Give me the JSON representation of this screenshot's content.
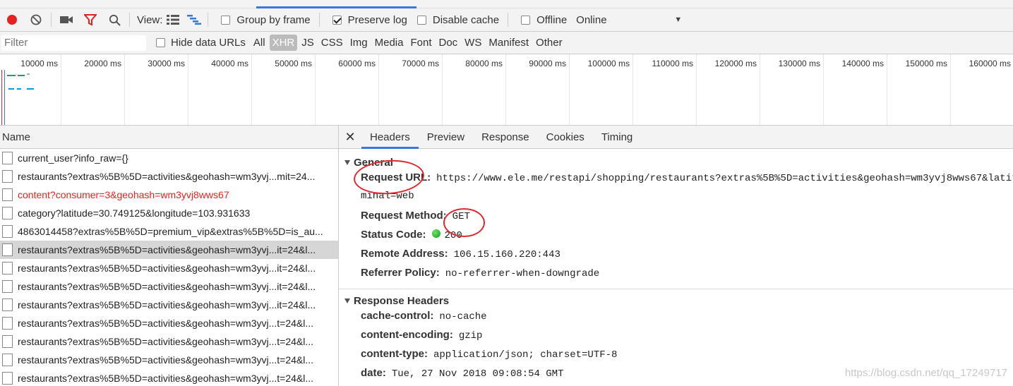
{
  "toolbar": {
    "view_label": "View:",
    "group_by_frame": "Group by frame",
    "preserve_log": "Preserve log",
    "disable_cache": "Disable cache",
    "offline": "Offline",
    "throttle": "Online"
  },
  "filterbar": {
    "placeholder": "Filter",
    "hide_data_urls": "Hide data URLs",
    "types": [
      "All",
      "XHR",
      "JS",
      "CSS",
      "Img",
      "Media",
      "Font",
      "Doc",
      "WS",
      "Manifest",
      "Other"
    ],
    "active_type": "XHR"
  },
  "overview": {
    "ticks": [
      "10000 ms",
      "20000 ms",
      "30000 ms",
      "40000 ms",
      "50000 ms",
      "60000 ms",
      "70000 ms",
      "80000 ms",
      "90000 ms",
      "100000 ms",
      "110000 ms",
      "120000 ms",
      "130000 ms",
      "140000 ms",
      "150000 ms",
      "160000 ms"
    ]
  },
  "requests": {
    "header": "Name",
    "rows": [
      {
        "label": "current_user?info_raw={}"
      },
      {
        "label": "restaurants?extras%5B%5D=activities&geohash=wm3yvj...mit=24..."
      },
      {
        "label": "content?consumer=3&geohash=wm3yvj8wws67",
        "error": true
      },
      {
        "label": "category?latitude=30.749125&longitude=103.931633"
      },
      {
        "label": "4863014458?extras%5B%5D=premium_vip&extras%5B%5D=is_au..."
      },
      {
        "label": "restaurants?extras%5B%5D=activities&geohash=wm3yvj...it=24&l...",
        "selected": true
      },
      {
        "label": "restaurants?extras%5B%5D=activities&geohash=wm3yvj...it=24&l..."
      },
      {
        "label": "restaurants?extras%5B%5D=activities&geohash=wm3yvj...it=24&l..."
      },
      {
        "label": "restaurants?extras%5B%5D=activities&geohash=wm3yvj...it=24&l..."
      },
      {
        "label": "restaurants?extras%5B%5D=activities&geohash=wm3yvj...t=24&l..."
      },
      {
        "label": "restaurants?extras%5B%5D=activities&geohash=wm3yvj...t=24&l..."
      },
      {
        "label": "restaurants?extras%5B%5D=activities&geohash=wm3yvj...t=24&l..."
      },
      {
        "label": "restaurants?extras%5B%5D=activities&geohash=wm3yvj...t=24&l..."
      }
    ]
  },
  "detail": {
    "tabs": [
      "Headers",
      "Preview",
      "Response",
      "Cookies",
      "Timing"
    ],
    "active_tab": "Headers",
    "general": {
      "title": "General",
      "request_url_label": "Request URL:",
      "request_url": "https://www.ele.me/restapi/shopping/restaurants?extras%5B%5D=activities&geohash=wm3yvj8wws67&latitud",
      "request_url_cont": "minal=web",
      "method_label": "Request Method:",
      "method": "GET",
      "status_label": "Status Code:",
      "status": "200",
      "remote_label": "Remote Address:",
      "remote": "106.15.160.220:443",
      "referrer_label": "Referrer Policy:",
      "referrer": "no-referrer-when-downgrade"
    },
    "response_headers": {
      "title": "Response Headers",
      "items": [
        {
          "k": "cache-control:",
          "v": "no-cache"
        },
        {
          "k": "content-encoding:",
          "v": "gzip"
        },
        {
          "k": "content-type:",
          "v": "application/json; charset=UTF-8"
        },
        {
          "k": "date:",
          "v": "Tue, 27 Nov 2018 09:08:54 GMT"
        }
      ]
    }
  },
  "watermark": "https://blog.csdn.net/qq_17249717",
  "colors": {
    "accent": "#3879d9",
    "record": "#e62222",
    "error_text": "#e62222",
    "annotation": "#e0282e"
  }
}
